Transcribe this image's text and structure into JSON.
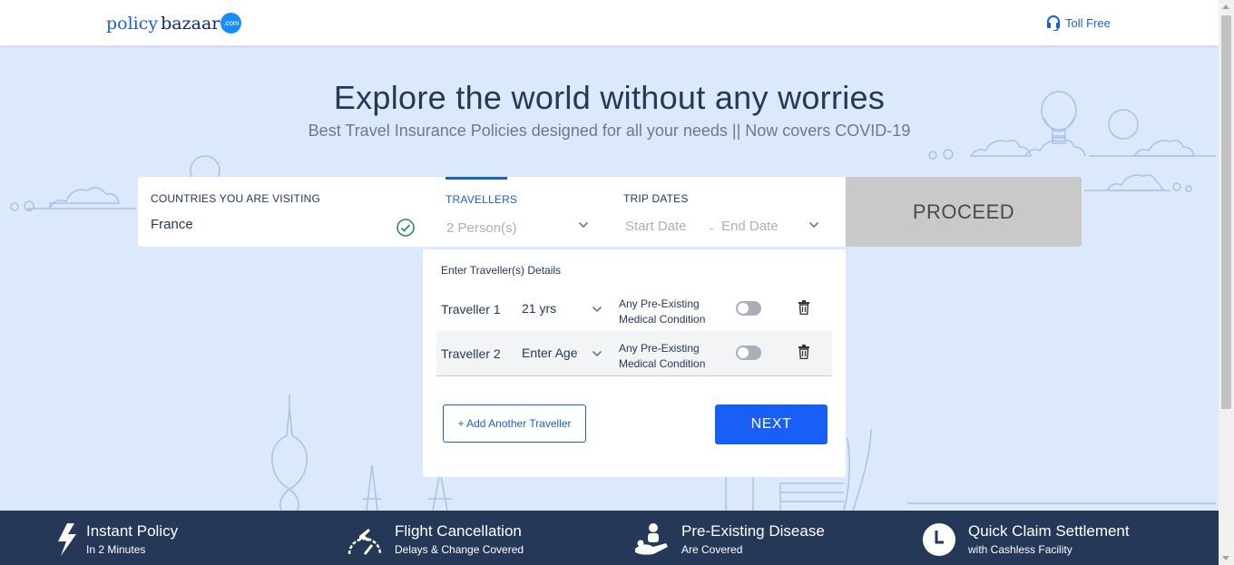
{
  "header": {
    "logo": {
      "part1": "policy",
      "part2": "bazaar",
      "badge": ".com"
    },
    "toll_free": "Toll Free"
  },
  "hero": {
    "title": "Explore the world without any worries",
    "subtitle": "Best Travel Insurance Policies designed for all your needs || Now covers COVID-19"
  },
  "search": {
    "countries_label": "COUNTRIES YOU ARE VISITING",
    "countries_value": "France",
    "travellers_label": "TRAVELLERS",
    "travellers_value": "2 Person(s)",
    "trip_dates_label": "TRIP DATES",
    "start_date": "Start Date",
    "separator": "-",
    "end_date": "End Date",
    "proceed_label": "PROCEED"
  },
  "traveller_panel": {
    "title": "Enter Traveller(s) Details",
    "travellers": [
      {
        "name": "Traveller 1",
        "age": "21 yrs",
        "condition_line1": "Any Pre-Existing",
        "condition_line2": "Medical Condition"
      },
      {
        "name": "Traveller 2",
        "age": "Enter Age",
        "condition_line1": "Any Pre-Existing",
        "condition_line2": "Medical Condition"
      }
    ],
    "add_button": "+ Add Another Traveller",
    "next_button": "NEXT"
  },
  "features": [
    {
      "icon": "lightning-icon",
      "title": "Instant Policy",
      "subtitle": "In 2 Minutes"
    },
    {
      "icon": "plane-gauge-icon",
      "title": "Flight Cancellation",
      "subtitle": "Delays & Change Covered"
    },
    {
      "icon": "doctor-patient-icon",
      "title": "Pre-Existing Disease",
      "subtitle": "Are Covered"
    },
    {
      "icon": "clock-icon",
      "title": "Quick Claim Settlement",
      "subtitle": "with Cashless Facility"
    }
  ],
  "colors": {
    "background": "#dce8fb",
    "primary": "#1a5fd8",
    "footer": "#253858",
    "proceed_disabled": "#c9c9c9",
    "success": "#2e8b57"
  }
}
